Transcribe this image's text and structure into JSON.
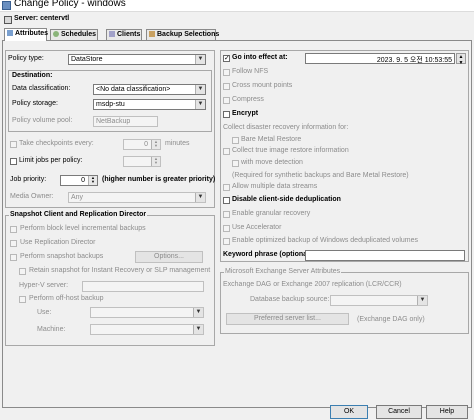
{
  "window": {
    "title": "Change Policy - windows"
  },
  "server": {
    "label": "Server: centervtl"
  },
  "tabs": [
    {
      "label": "Attributes",
      "icon": "attributes-icon"
    },
    {
      "label": "Schedules",
      "icon": "schedules-icon"
    },
    {
      "label": "Clients",
      "icon": "clients-icon"
    },
    {
      "label": "Backup Selections",
      "icon": "backup-selections-icon"
    }
  ],
  "left": {
    "policy_type_label": "Policy type:",
    "policy_type_value": "DataStore",
    "destination_label": "Destination:",
    "data_classification_label": "Data classification:",
    "data_classification_value": "<No data classification>",
    "policy_storage_label": "Policy storage:",
    "policy_storage_value": "msdp-stu",
    "policy_volume_pool_label": "Policy volume pool:",
    "policy_volume_pool_value": "NetBackup",
    "take_checkpoints_label": "Take checkpoints every:",
    "take_checkpoints_value": "0",
    "minutes_label": "minutes",
    "limit_jobs_label": "Limit jobs per policy:",
    "job_priority_label": "Job priority:",
    "job_priority_value": "0",
    "job_priority_hint": "(higher number is greater priority)",
    "media_owner_label": "Media Owner:",
    "media_owner_value": "Any",
    "snapshot_group_label": "Snapshot Client and Replication Director",
    "perform_block_label": "Perform block level incremental backups",
    "use_replication_label": "Use Replication Director",
    "perform_snapshot_label": "Perform snapshot backups",
    "options_button": "Options...",
    "retain_snapshot_label": "Retain snapshot for Instant Recovery or SLP management",
    "hyperv_label": "Hyper-V server:",
    "offhost_label": "Perform off-host backup",
    "use_label": "Use:",
    "machine_label": "Machine:"
  },
  "right": {
    "go_into_effect_label": "Go into effect at:",
    "go_into_effect_value": "2023. 9. 5 오전 10:53:55",
    "follow_nfs_label": "Follow NFS",
    "cross_mount_label": "Cross mount points",
    "compress_label": "Compress",
    "encrypt_label": "Encrypt",
    "collect_disaster_label": "Collect disaster recovery information for:",
    "bare_metal_label": "Bare Metal Restore",
    "collect_true_image_label": "Collect true image restore information",
    "with_move_detection_label": "with move detection",
    "synthetic_note": "(Required for synthetic backups and Bare Metal Restore)",
    "allow_multiple_label": "Allow multiple data streams",
    "disable_dedup_label": "Disable client-side deduplication",
    "enable_granular_label": "Enable granular recovery",
    "use_accelerator_label": "Use Accelerator",
    "enable_optimized_label": "Enable optimized backup of Windows deduplicated volumes",
    "keyword_label": "Keyword phrase (optional):",
    "keyword_value": "",
    "exchange_group_label": "Microsoft Exchange Server Attributes",
    "exchange_dag_label": "Exchange DAG or Exchange 2007 replication (LCR/CCR)",
    "database_backup_source_label": "Database backup source:",
    "preferred_server_button": "Preferred server list...",
    "exchange_dag_only": "(Exchange DAG only)"
  },
  "footer": {
    "ok": "OK",
    "cancel": "Cancel",
    "help": "Help"
  }
}
